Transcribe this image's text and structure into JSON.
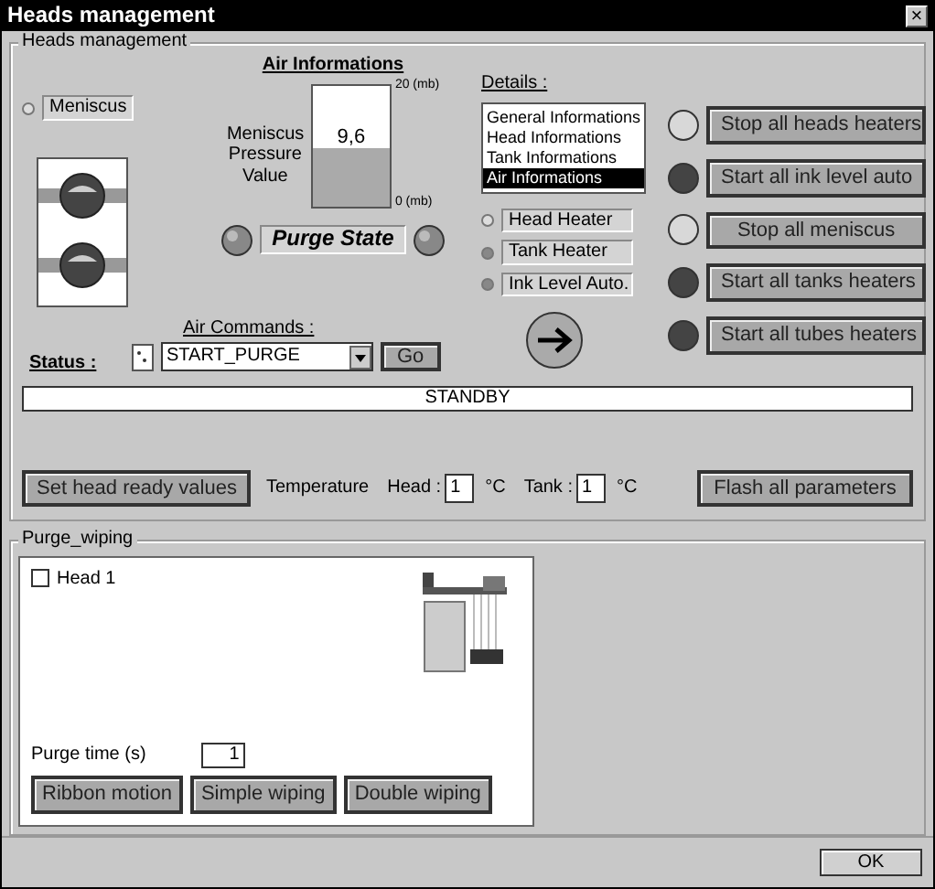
{
  "window": {
    "title": "Heads management",
    "close": "×"
  },
  "heads_group": {
    "title": "Heads management"
  },
  "meniscus": {
    "label": "Meniscus",
    "on": false
  },
  "air_informations": {
    "title": "Air Informations",
    "pressure_label": "Meniscus Pressure Value",
    "value": "9,6",
    "level": 0.48,
    "max_label": "20 (mb)",
    "min_label": "0 (mb)",
    "purge_state": "Purge State"
  },
  "air_commands": {
    "label": "Air Commands :",
    "command": "START_PURGE",
    "go": "Go"
  },
  "status": {
    "label": "Status :",
    "value": "STANDBY"
  },
  "details": {
    "label": "Details :",
    "items": [
      {
        "label": "General Informations",
        "selected": false
      },
      {
        "label": "Head Informations",
        "selected": false
      },
      {
        "label": "Tank Informations",
        "selected": false
      },
      {
        "label": "Air Informations",
        "selected": true
      }
    ]
  },
  "indicators": [
    {
      "label": "Head Heater",
      "on": false
    },
    {
      "label": "Tank Heater",
      "on": true
    },
    {
      "label": "Ink Level Auto.",
      "on": true
    }
  ],
  "actions": [
    {
      "label": "Stop all heads heaters",
      "on": true
    },
    {
      "label": "Start all ink level auto",
      "on": false
    },
    {
      "label": "Stop all meniscus",
      "on": true
    },
    {
      "label": "Start all tanks heaters",
      "on": false
    },
    {
      "label": "Start all tubes heaters",
      "on": false
    }
  ],
  "set_ready": "Set head ready values",
  "temperature": {
    "label": "Temperature",
    "head_label": "Head :",
    "head_value": "1",
    "head_unit": "°C",
    "tank_label": "Tank :",
    "tank_value": "1",
    "tank_unit": "°C"
  },
  "flash": "Flash all parameters",
  "purge_wiping": {
    "title": "Purge_wiping",
    "heads": [
      {
        "label": "Head 1",
        "checked": false
      }
    ],
    "purge_time_label": "Purge time (s)",
    "purge_time": "1",
    "buttons": [
      "Ribbon motion",
      "Simple wiping",
      "Double wiping"
    ]
  },
  "ok": "OK"
}
